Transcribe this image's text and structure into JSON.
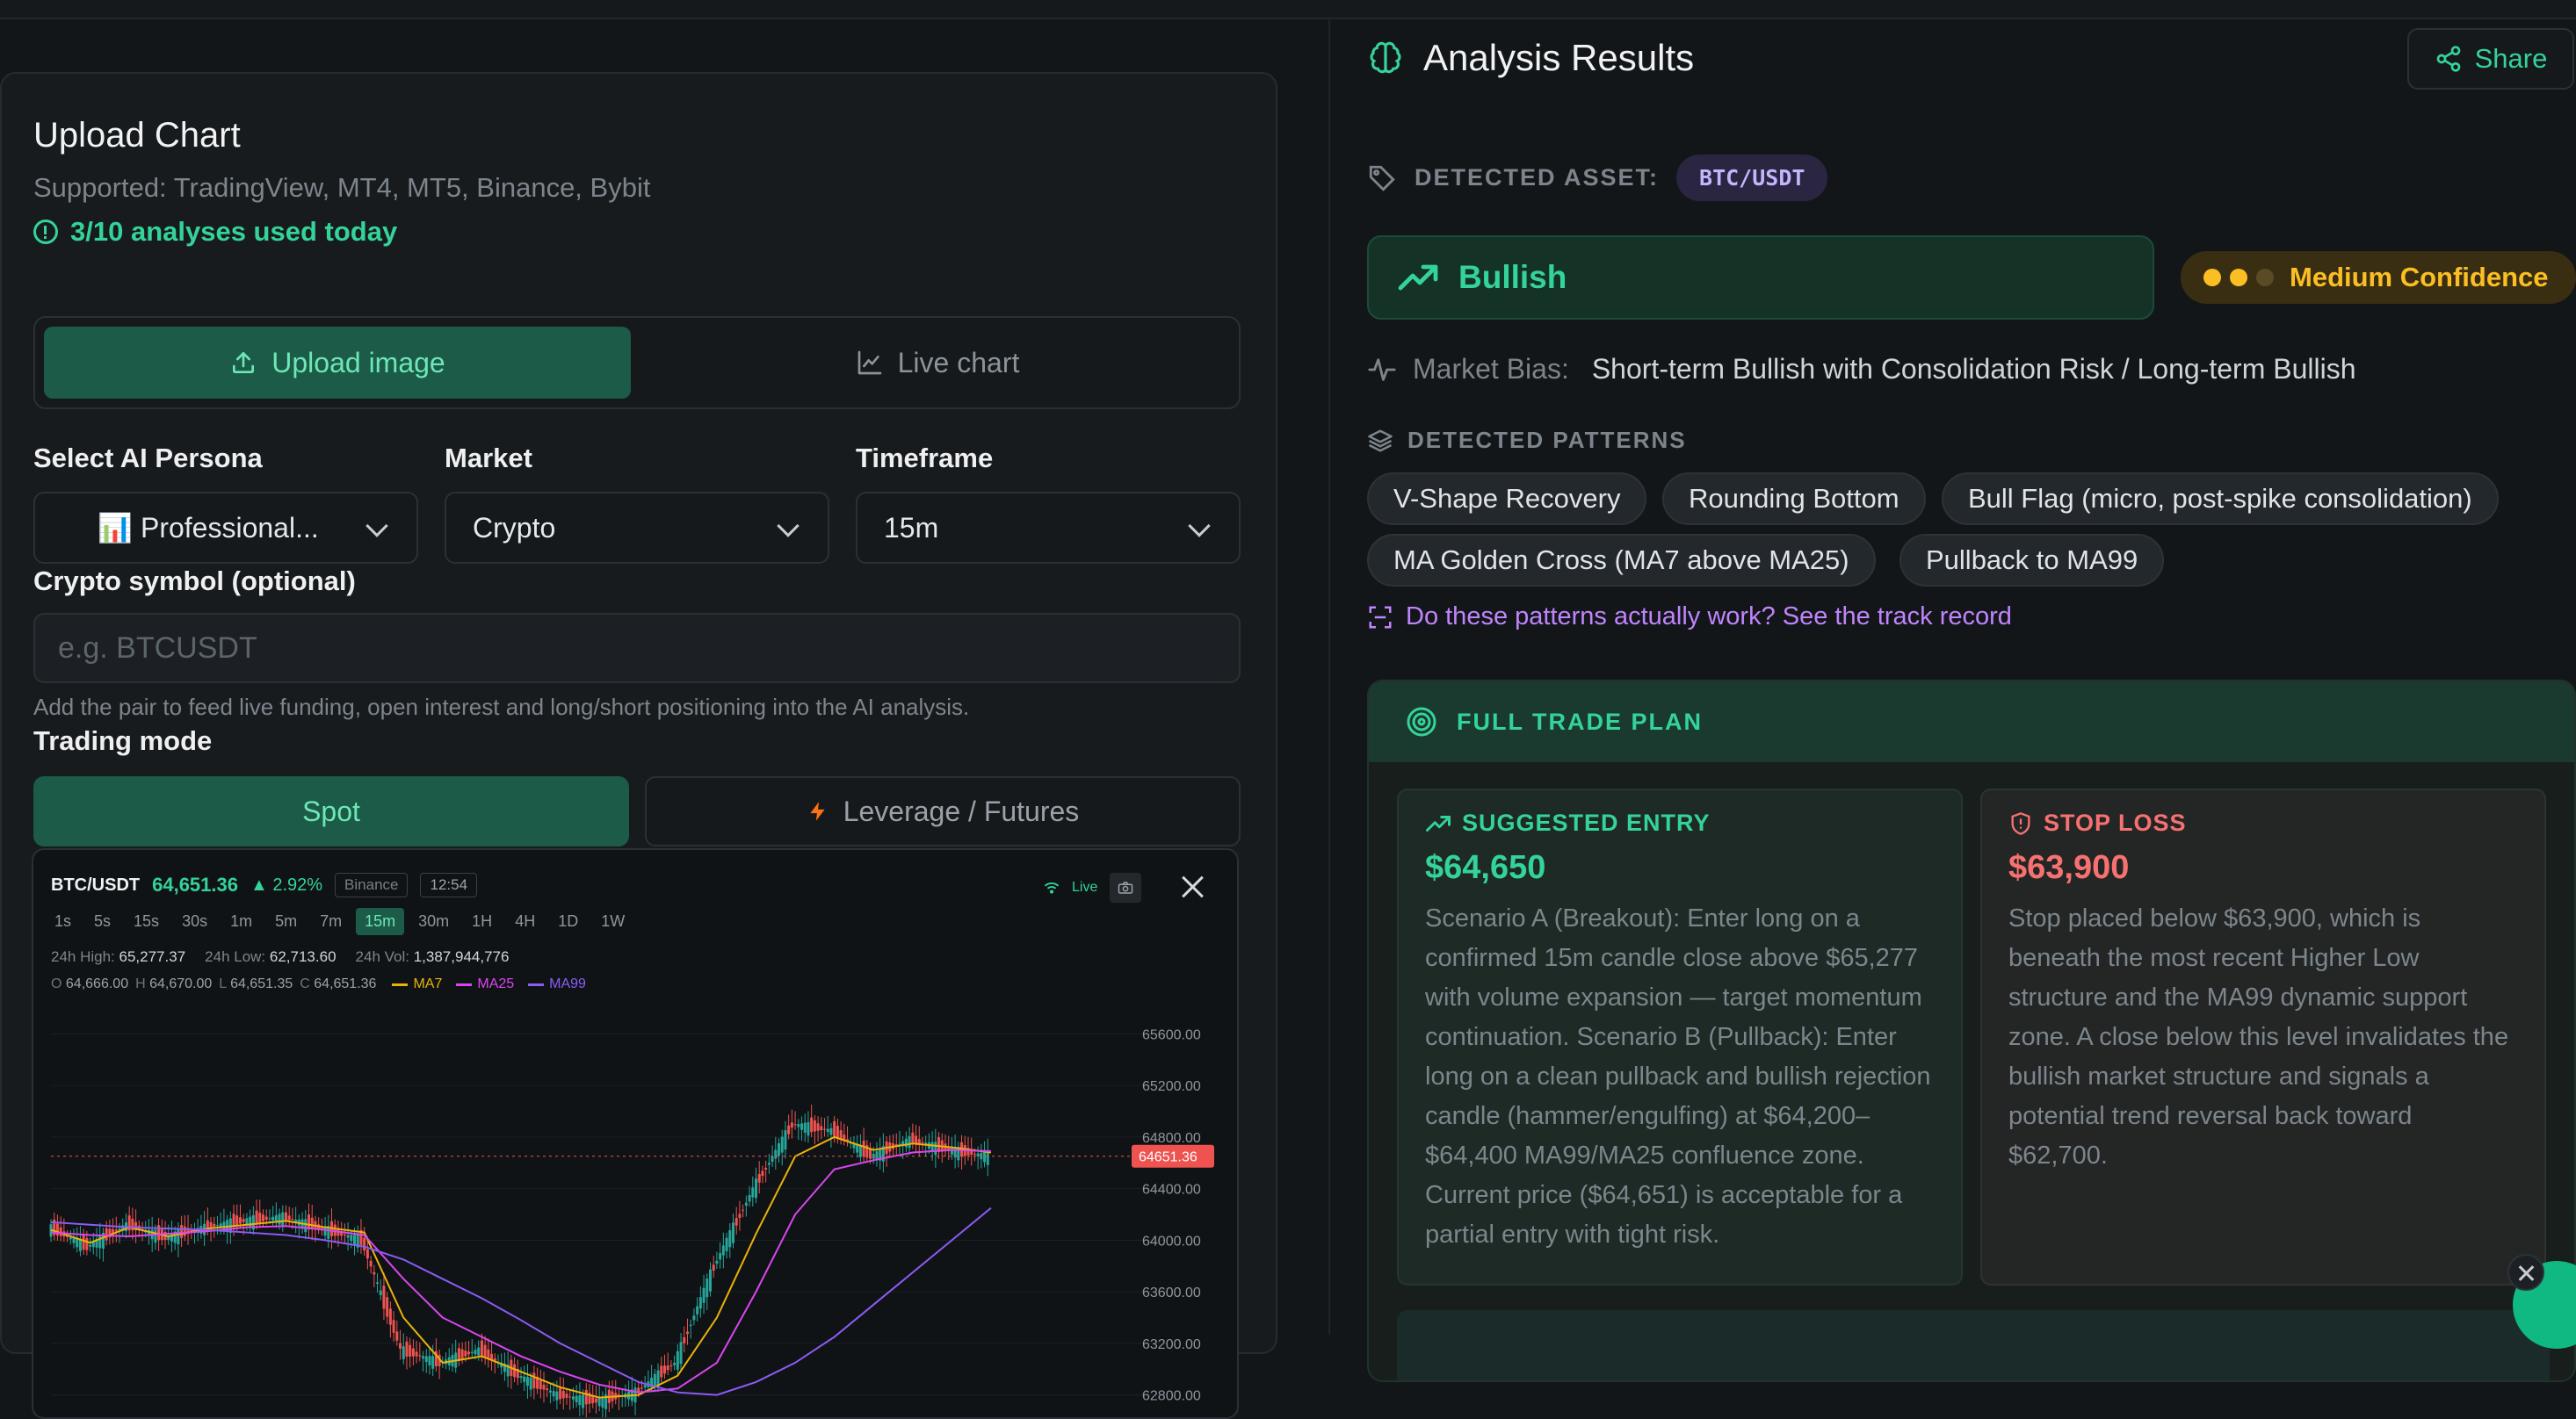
{
  "upload": {
    "title": "Upload Chart",
    "supported": "Supported: TradingView, MT4, MT5, Binance, Bybit",
    "usage": "3/10 analyses used today",
    "tabs": {
      "upload": "Upload image",
      "live": "Live chart"
    }
  },
  "form": {
    "persona_label": "Select AI Persona",
    "persona_value": "📊 Professional...",
    "market_label": "Market",
    "market_value": "Crypto",
    "timeframe_label": "Timeframe",
    "timeframe_value": "15m",
    "symbol_label": "Crypto symbol (optional)",
    "symbol_placeholder": "e.g. BTCUSDT",
    "symbol_help": "Add the pair to feed live funding, open interest and long/short positioning into the AI analysis.",
    "mode_label": "Trading mode",
    "mode_spot": "Spot",
    "mode_leverage": "Leverage / Futures"
  },
  "chart_widget": {
    "symbol": "BTC/USDT",
    "price": "64,651.36",
    "change": "▲ 2.92%",
    "exchange": "Binance",
    "time": "12:54",
    "live": "Live",
    "timeframes": [
      "1s",
      "5s",
      "15s",
      "30s",
      "1m",
      "5m",
      "7m",
      "15m",
      "30m",
      "1H",
      "4H",
      "1D",
      "1W"
    ],
    "active_timeframe": "15m",
    "stats": {
      "high_label": "24h High:",
      "high": "65,277.37",
      "low_label": "24h Low:",
      "low": "62,713.60",
      "vol_label": "24h Vol:",
      "vol": "1,387,944,776"
    },
    "ohlc": {
      "o": "64,666.00",
      "h": "64,670.00",
      "l": "64,651.35",
      "c": "64,651.36"
    },
    "legend": [
      {
        "name": "MA7",
        "color": "#eab308"
      },
      {
        "name": "MA25",
        "color": "#d946ef"
      },
      {
        "name": "MA99",
        "color": "#8b5cf6"
      }
    ],
    "current_price_label": "64651.36"
  },
  "chart_data": {
    "type": "line",
    "ylim": [
      62600,
      65800
    ],
    "yticks": [
      "65600.00",
      "65200.00",
      "64800.00",
      "64400.00",
      "64000.00",
      "63600.00",
      "63200.00",
      "62800.00"
    ],
    "current_price": 64651.36,
    "series": [
      {
        "name": "MA7",
        "values": [
          64080,
          63980,
          64100,
          64030,
          64090,
          64120,
          64150,
          64100,
          64060,
          63400,
          63050,
          63100,
          62980,
          62860,
          62780,
          62800,
          62950,
          63400,
          64050,
          64650,
          64800,
          64700,
          64750,
          64720,
          64680
        ]
      },
      {
        "name": "MA25",
        "values": [
          64060,
          64040,
          64030,
          64050,
          64070,
          64100,
          64110,
          64080,
          64040,
          63700,
          63400,
          63250,
          63100,
          62980,
          62880,
          62820,
          62850,
          63050,
          63600,
          64200,
          64550,
          64620,
          64680,
          64700,
          64690
        ]
      },
      {
        "name": "MA99",
        "values": [
          64140,
          64120,
          64100,
          64090,
          64080,
          64060,
          64040,
          64000,
          63950,
          63850,
          63700,
          63550,
          63380,
          63200,
          63050,
          62900,
          62820,
          62800,
          62900,
          63050,
          63250,
          63500,
          63750,
          64000,
          64250
        ]
      },
      {
        "name": "price",
        "values": [
          64100,
          63950,
          64120,
          64020,
          64100,
          64150,
          64180,
          64090,
          64000,
          63150,
          63050,
          63150,
          62950,
          62800,
          62750,
          62820,
          63050,
          63800,
          64400,
          64900,
          64850,
          64650,
          64780,
          64700,
          64651
        ]
      }
    ]
  },
  "analysis": {
    "title": "Analysis Results",
    "share": "Share",
    "asset_label": "DETECTED ASSET:",
    "asset": "BTC/USDT",
    "sentiment": "Bullish",
    "confidence": "Medium Confidence",
    "confidence_level": 2,
    "confidence_max": 3,
    "bias_label": "Market Bias:",
    "bias_value": "Short-term Bullish with Consolidation Risk / Long-term Bullish",
    "patterns_label": "DETECTED PATTERNS",
    "patterns": [
      "V-Shape Recovery",
      "Rounding Bottom",
      "Bull Flag (micro, post-spike consolidation)",
      "MA Golden Cross (MA7 above MA25)",
      "Pullback to MA99"
    ],
    "track_record": "Do these patterns actually work? See the track record"
  },
  "plan": {
    "title": "FULL TRADE PLAN",
    "entry_label": "SUGGESTED ENTRY",
    "entry_price": "$64,650",
    "entry_text": "Scenario A (Breakout): Enter long on a confirmed 15m candle close above $65,277 with volume expansion — target momentum continuation. Scenario B (Pullback): Enter long on a clean pullback and bullish rejection candle (hammer/engulfing) at $64,200–$64,400 MA99/MA25 confluence zone. Current price ($64,651) is acceptable for a partial entry with tight risk.",
    "stop_label": "STOP LOSS",
    "stop_price": "$63,900",
    "stop_text": "Stop placed below $63,900, which is beneath the most recent Higher Low structure and the MA99 dynamic support zone. A close below this level invalidates the bullish market structure and signals a potential trend reversal back toward $62,700."
  },
  "colors": {
    "accent": "#34d399",
    "warning": "#fbbf24",
    "danger": "#f87171",
    "purple": "#c084fc"
  }
}
